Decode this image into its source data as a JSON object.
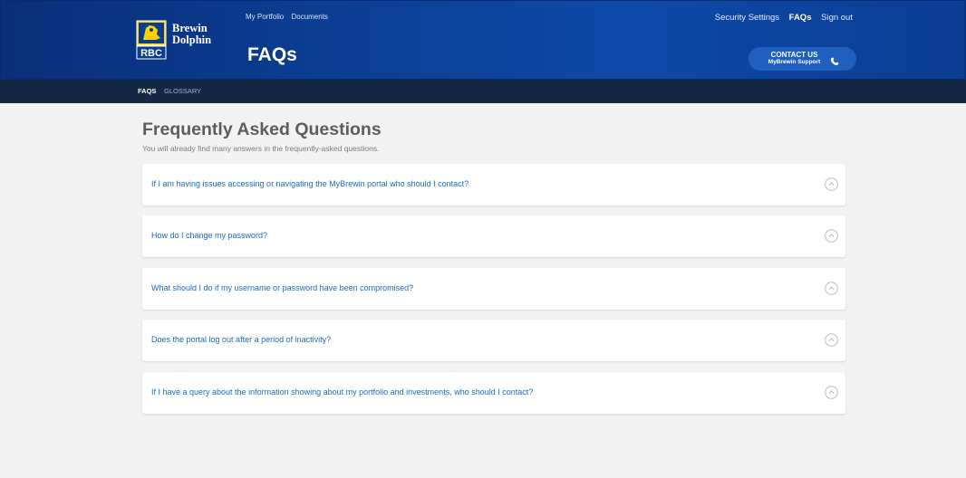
{
  "brand": {
    "line1": "Brewin",
    "line2": "Dolphin",
    "logo_icon": "rbc-lion-shield-icon",
    "logo_text": "RBC"
  },
  "header": {
    "nav_left": [
      "My Portfolio",
      "Documents"
    ],
    "title": "FAQs",
    "nav_right": [
      {
        "label": "Security Settings",
        "active": false
      },
      {
        "label": "FAQs",
        "active": true
      },
      {
        "label": "Sign out",
        "active": false
      }
    ],
    "contact": {
      "line1": "CONTACT US",
      "line2": "MyBrewin Support",
      "icon": "phone-icon"
    }
  },
  "subnav": {
    "tabs": [
      {
        "label": "FAQS",
        "active": true
      },
      {
        "label": "GLOSSARY",
        "active": false
      }
    ]
  },
  "main": {
    "heading": "Frequently Asked Questions",
    "intro": "You will already find many answers in the frequently-asked questions.",
    "faqs": [
      {
        "question": "If I am having issues accessing or navigating the MyBrewin portal who should I contact?",
        "expanded": false
      },
      {
        "question": "How do I change my password?",
        "expanded": false
      },
      {
        "question": "What should I do if my username or password have been compromised?",
        "expanded": false
      },
      {
        "question": "Does the portal log out after a period of inactivity?",
        "expanded": false
      },
      {
        "question": "If I have a query about the information showing about my portfolio and investments, who should I contact?",
        "expanded": false
      }
    ]
  },
  "colors": {
    "header_blue": "#0b3c8f",
    "subnav_navy": "#142846",
    "link_blue": "#1d6ac0",
    "background": "#f3f3f3"
  }
}
